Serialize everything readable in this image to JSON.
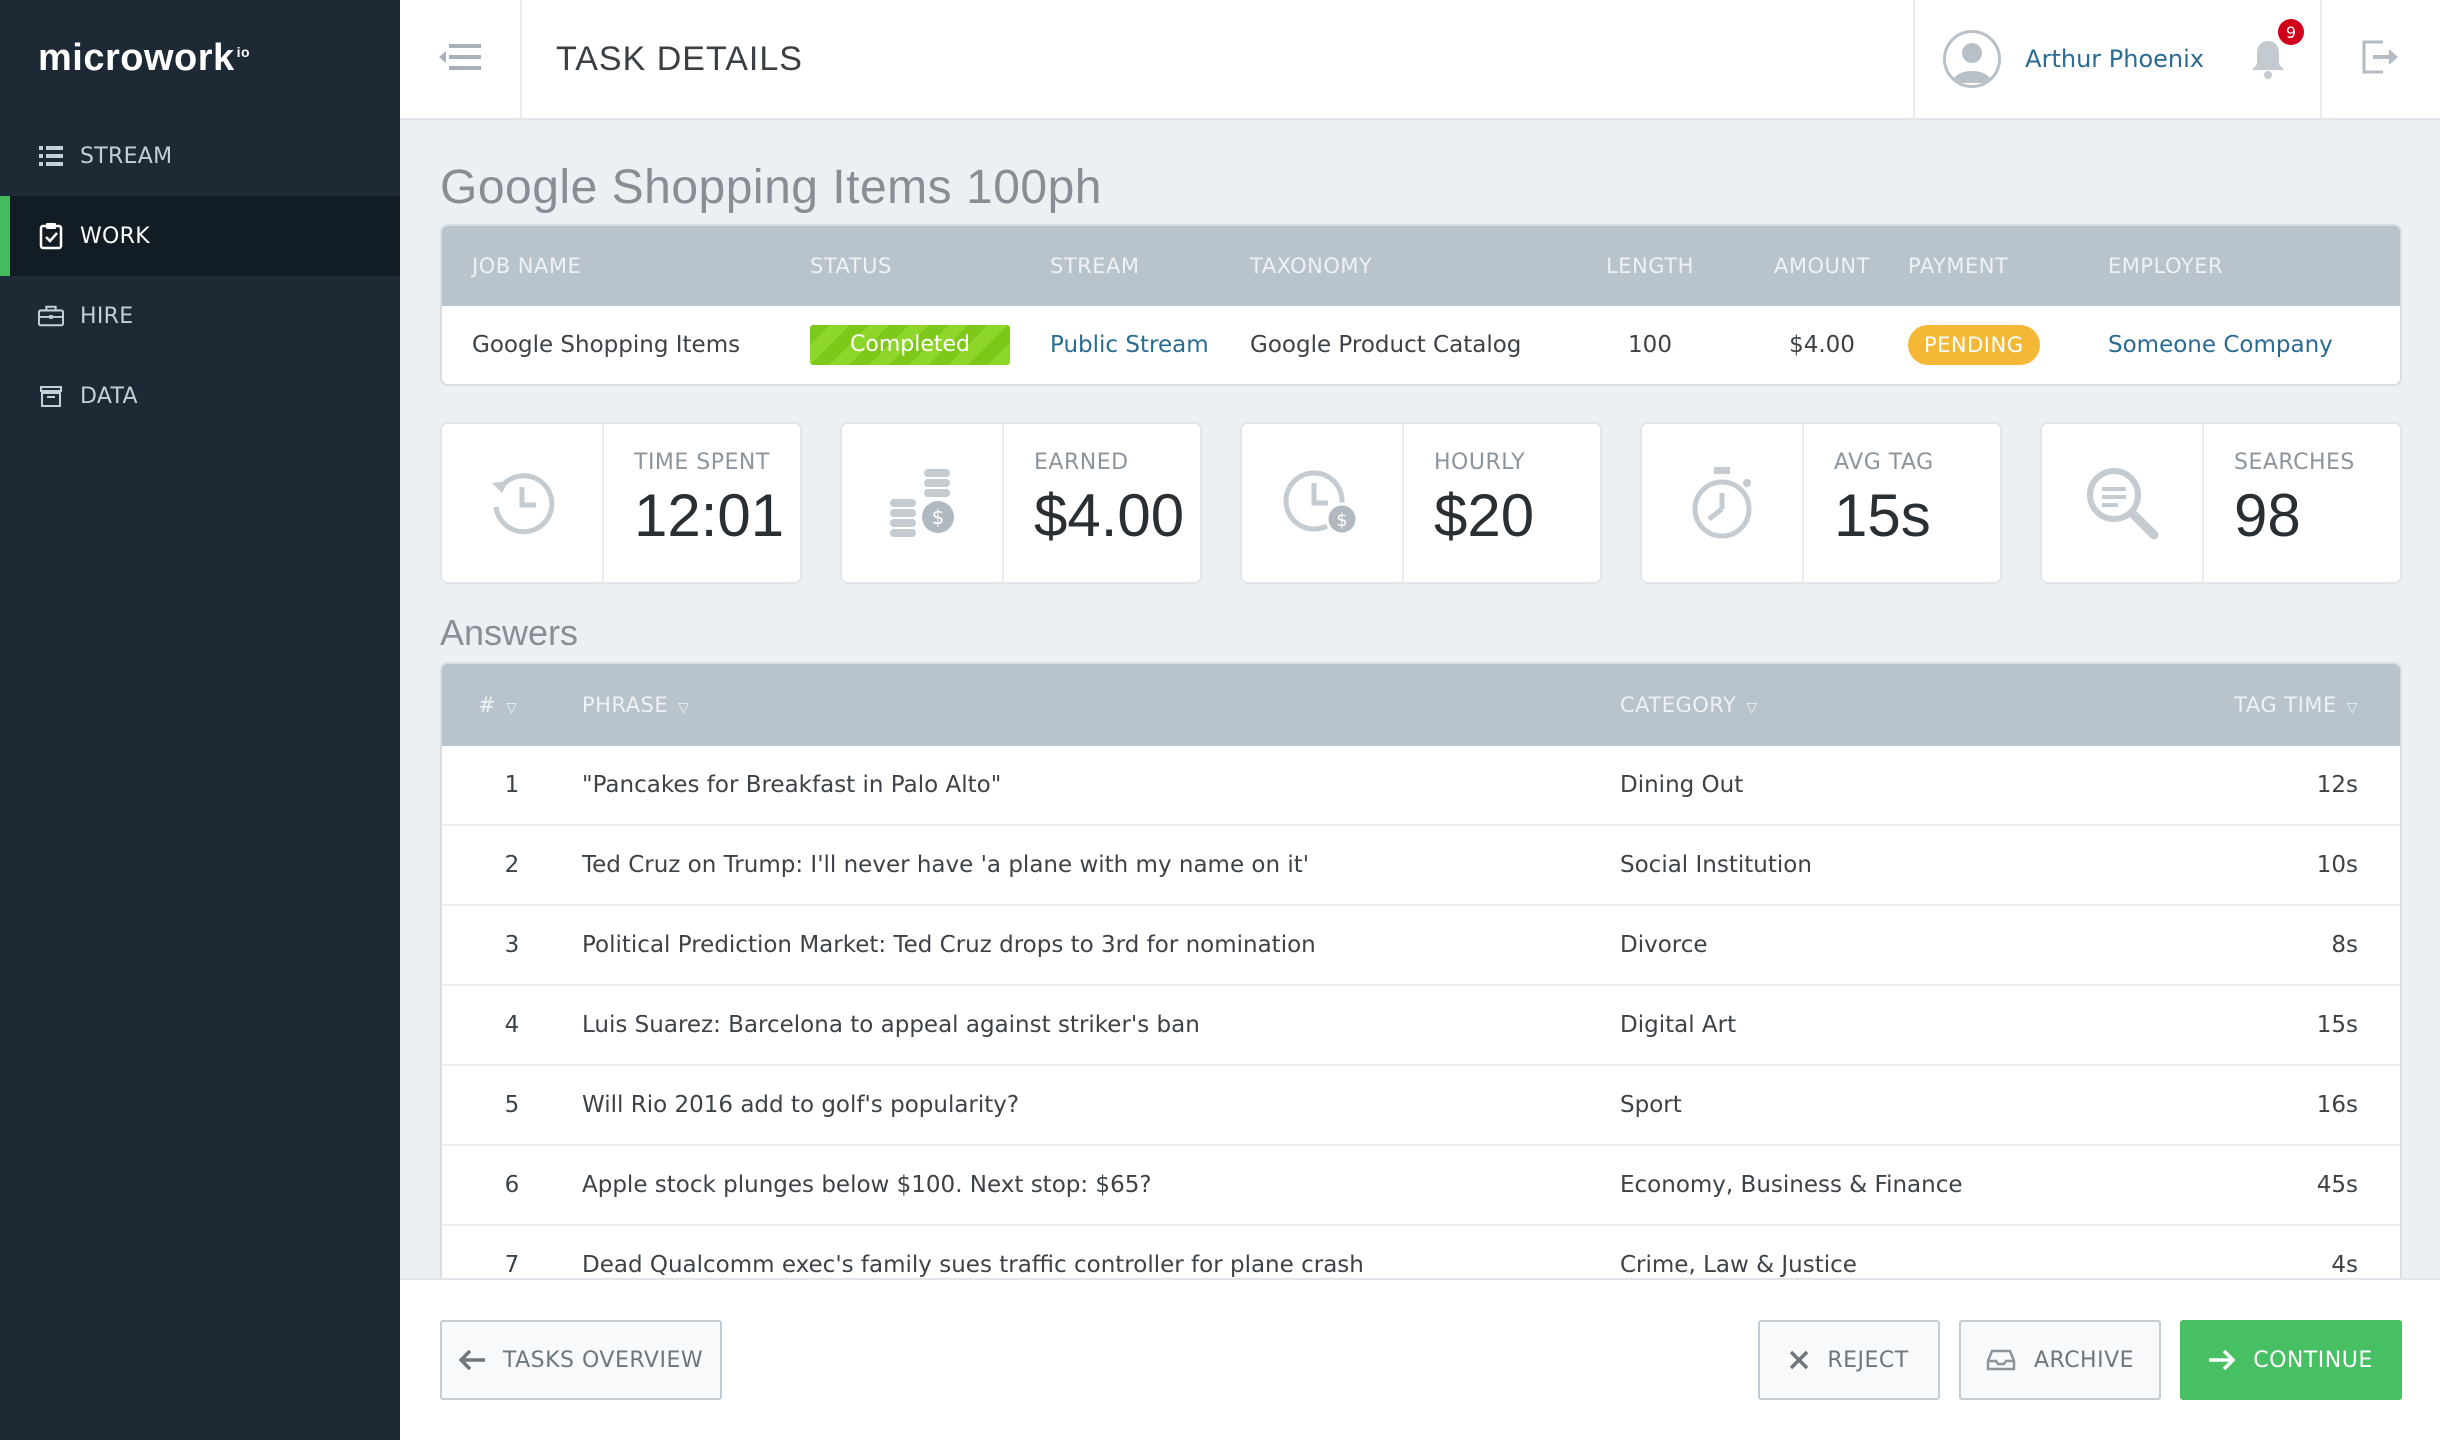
{
  "app": {
    "logo": "microwork",
    "logo_suffix": "io"
  },
  "sidebar": {
    "items": [
      {
        "label": "STREAM",
        "icon": "list-icon",
        "active": false
      },
      {
        "label": "WORK",
        "icon": "clipboard-check-icon",
        "active": true
      },
      {
        "label": "HIRE",
        "icon": "briefcase-icon",
        "active": false
      },
      {
        "label": "DATA",
        "icon": "archive-box-icon",
        "active": false
      }
    ]
  },
  "header": {
    "title": "TASK DETAILS",
    "user_name": "Arthur Phoenix",
    "notification_count": "9"
  },
  "job": {
    "title": "Google Shopping Items 100ph",
    "columns": [
      "JOB NAME",
      "STATUS",
      "STREAM",
      "TAXONOMY",
      "LENGTH",
      "AMOUNT",
      "PAYMENT",
      "EMPLOYER"
    ],
    "row": {
      "name": "Google Shopping Items",
      "status": "Completed",
      "stream": "Public Stream",
      "taxonomy": "Google Product Catalog",
      "length": "100",
      "amount": "$4.00",
      "payment": "PENDING",
      "employer": "Someone Company"
    }
  },
  "stats": [
    {
      "label": "TIME SPENT",
      "value": "12:01",
      "icon": "history-clock-icon"
    },
    {
      "label": "EARNED",
      "value": "$4.00",
      "icon": "coins-icon"
    },
    {
      "label": "HOURLY",
      "value": "$20",
      "icon": "clock-dollar-icon"
    },
    {
      "label": "AVG TAG",
      "value": "15s",
      "icon": "stopwatch-icon"
    },
    {
      "label": "SEARCHES",
      "value": "98",
      "icon": "search-icon"
    }
  ],
  "answers": {
    "title": "Answers",
    "columns": {
      "num": "#",
      "phrase": "PHRASE",
      "category": "CATEGORY",
      "tag_time": "TAG TIME"
    },
    "rows": [
      {
        "num": "1",
        "phrase": "\"Pancakes for Breakfast in Palo Alto\"",
        "category": "Dining Out",
        "tag_time": "12s"
      },
      {
        "num": "2",
        "phrase": "Ted Cruz on Trump: I'll never have 'a plane with my name on it'",
        "category": "Social Institution",
        "tag_time": "10s"
      },
      {
        "num": "3",
        "phrase": "Political Prediction Market: Ted Cruz drops to 3rd for nomination",
        "category": "Divorce",
        "tag_time": "8s"
      },
      {
        "num": "4",
        "phrase": "Luis Suarez: Barcelona to appeal against striker's ban",
        "category": "Digital Art",
        "tag_time": "15s"
      },
      {
        "num": "5",
        "phrase": "Will Rio 2016 add to golf's popularity?",
        "category": "Sport",
        "tag_time": "16s"
      },
      {
        "num": "6",
        "phrase": "Apple stock plunges below $100. Next stop: $65?",
        "category": "Economy, Business & Finance",
        "tag_time": "45s"
      },
      {
        "num": "7",
        "phrase": "Dead Qualcomm exec's family sues traffic controller for plane crash",
        "category": "Crime, Law & Justice",
        "tag_time": "4s"
      }
    ]
  },
  "footer": {
    "overview_label": "TASKS OVERVIEW",
    "reject_label": "REJECT",
    "archive_label": "ARCHIVE",
    "continue_label": "CONTINUE"
  },
  "colors": {
    "sidebar_bg": "#1d2a35",
    "accent_green": "#43bd5c",
    "link_blue": "#2a6b92",
    "pending_orange": "#f4b836",
    "table_header": "#b9c3cb",
    "badge_red": "#d0021b"
  }
}
